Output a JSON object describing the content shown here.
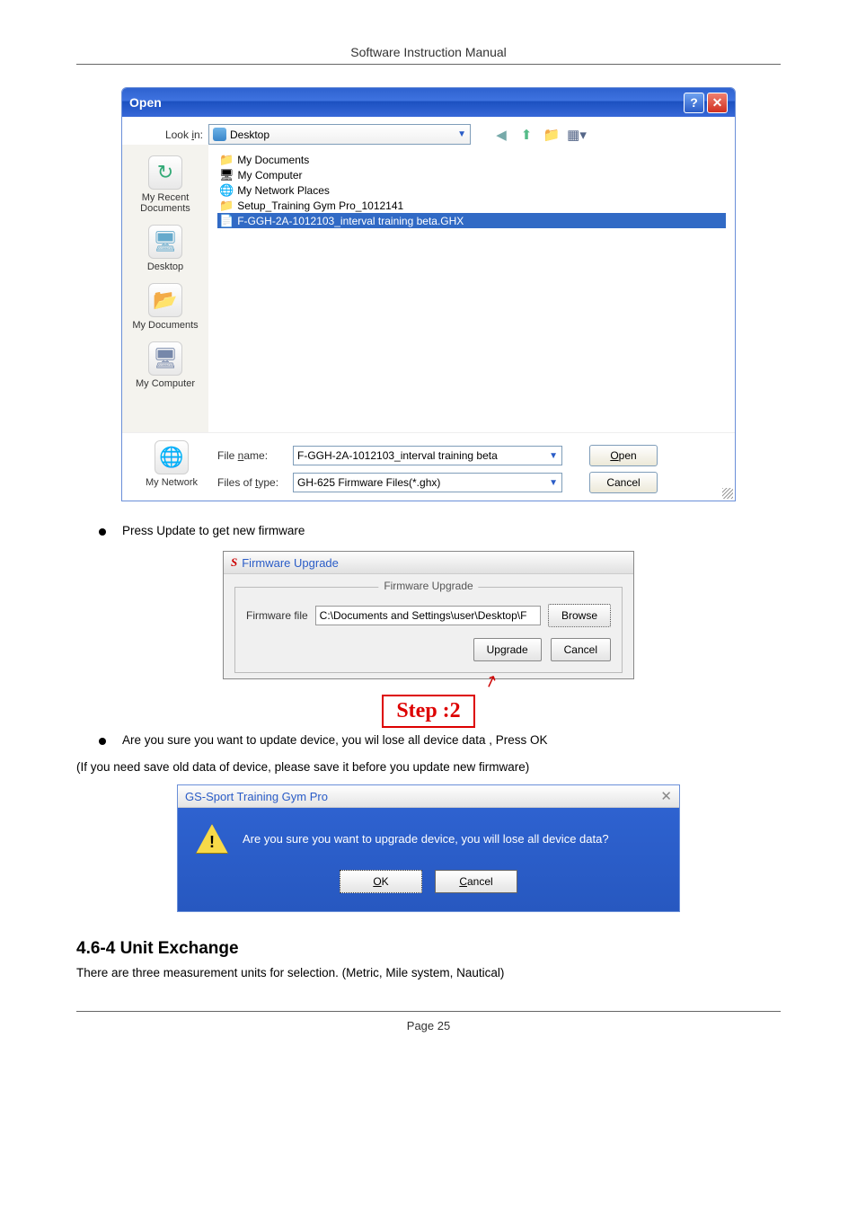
{
  "header": {
    "title": "Software Instruction Manual"
  },
  "openDialog": {
    "title": "Open",
    "lookInLabel": "Look in:",
    "lookInValue": "Desktop",
    "places": {
      "recent": "My Recent Documents",
      "desktop": "Desktop",
      "mydocs": "My Documents",
      "mycomp": "My Computer",
      "mynet": "My Network"
    },
    "files": {
      "f1": "My Documents",
      "f2": "My Computer",
      "f3": "My Network Places",
      "f4": "Setup_Training Gym Pro_1012141",
      "f5": "F-GGH-2A-1012103_interval training beta.GHX"
    },
    "fileNameLabel": "File name:",
    "fileNameValue": "F-GGH-2A-1012103_interval training beta",
    "fileTypeLabel": "Files of type:",
    "fileTypeValue": "GH-625 Firmware Files(*.ghx)",
    "openBtn": "Open",
    "cancelBtn": "Cancel"
  },
  "instructions": {
    "bullet1": "Press Update to get new firmware",
    "bullet2": "Are you sure you want to update device, you wil lose all device data , Press OK",
    "note": "(If you need save old data of device, please save it before you update new firmware)"
  },
  "fwDialog": {
    "title": "Firmware Upgrade",
    "legend": "Firmware Upgrade",
    "label": "Firmware file",
    "path": "C:\\Documents and Settings\\user\\Desktop\\F",
    "browse": "Browse",
    "upgrade": "Upgrade",
    "cancel": "Cancel",
    "step": "Step :2"
  },
  "alertDialog": {
    "title": "GS-Sport Training Gym Pro",
    "msg": "Are you sure you want to upgrade device, you will lose all device data?",
    "ok": "OK",
    "cancel": "Cancel"
  },
  "section": {
    "heading": "4.6-4 Unit Exchange",
    "text": "There are three measurement units for selection. (Metric, Mile system, Nautical)"
  },
  "footer": {
    "page": "Page 25"
  }
}
